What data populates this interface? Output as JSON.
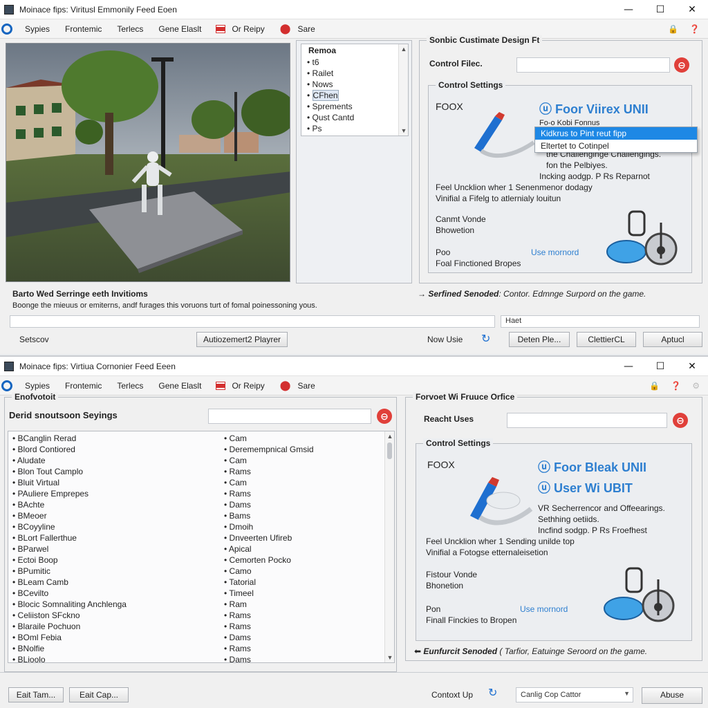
{
  "window1": {
    "title": "Moinace fips: Viritusl Emmonily Feed Eoen",
    "controls": {
      "minimize": "—",
      "maximize": "☐",
      "close": "✕"
    },
    "menu": [
      "Sypies",
      "Frontemic",
      "Terlecs",
      "Gene Elaslt",
      "Or Reipy",
      "Sare"
    ],
    "list_panel": {
      "header": "Remoa",
      "items": [
        "t6",
        "Railet",
        "Nows",
        "CFhen",
        "Sprements",
        "Qust Cantd",
        "Ps"
      ],
      "selected_index": 3
    },
    "right_panel": {
      "title": "Sonbic Custimate Design Ft",
      "control_files_label": "Control Filec.",
      "control_files_value": "",
      "control_settings_title": "Control Settings",
      "foox": "FOOX",
      "brand": "Foor Viirex UNII",
      "line_partial": "Fo-o Kobi Fonnus",
      "dropdown": [
        "Kidkrus to Pint reut fipp",
        "Eltertet to Cotinpel"
      ],
      "text_lines": [
        "the Challenginge Challengings.",
        "fon the Pelbiyes.",
        "Incking aodgp. P Rs Reparnot",
        "Feel Uncklion wher 1 Senenmenor dodagy",
        "Vinifial a Fifelg to atlernialy louitun"
      ],
      "block2": [
        "Canmt Vonde",
        "Bhowetion"
      ],
      "block3_left": "Poo",
      "block3_link": "Use mornord",
      "block3_bottom": "Foal Finctioned Bropes"
    },
    "bottom": {
      "hint_title": "Barto Wed Serringe eeth Invitioms",
      "hint_text": "Boonge the mieuus or emiterns, andf furages this voruons turt of fomal poinessoning yous.",
      "arrow_text_bold": "Serfined Senoded",
      "arrow_text_rest": ": Contor. Edmnge Surpord on the game.",
      "input_left": "",
      "input_right": "Haet",
      "status": "Setscov",
      "center_button": "Autiozemert2 Playrer",
      "now_use": "Now Usie",
      "buttons": [
        "Deten Ple...",
        "ClettierCL",
        "Aptucl"
      ]
    }
  },
  "window2": {
    "title": "Moinace fips: Virtiua Cornonier Feed Eeen",
    "controls": {
      "minimize": "—",
      "maximize": "☐",
      "close": "✕"
    },
    "menu": [
      "Sypies",
      "Frontemic",
      "Terlecs",
      "Gene Elaslt",
      "Or Reipy",
      "Sare"
    ],
    "left_panel": {
      "title": "Enofvotoit",
      "settings_title": "Derid snoutsoon Seyings",
      "search_value": "",
      "col1": [
        "BCanglin Rerad",
        "Blord Contiored",
        "Aludate",
        "Blon Tout Camplo",
        "Bluit Virtual",
        "PAuliere Emprepes",
        "BAchte",
        "BMeoer",
        "BCoyyline",
        "BLort Fallerthue",
        "BParwel",
        "Ectoi Boop",
        "BPumitic",
        "BLeam Camb",
        "BCevilto",
        "Blocic Somnaliting Anchlenga",
        "Celiiston SFckno",
        "Blaraile Pochuon",
        "BOml Febia",
        "BNolfie",
        "BLioolo"
      ],
      "col2": [
        "Cam",
        "Deremempnical Gmsid",
        "Cam",
        "Rams",
        "Cam",
        "Rams",
        "Dams",
        "Bams",
        "Dmoih",
        "Dnveerten Ufireb",
        "Apical",
        "Cemorten Pocko",
        "Camo",
        "Tatorial",
        "Timeel",
        "Ram",
        "Rams",
        "Rams",
        "Dams",
        "Rams",
        "Dams"
      ]
    },
    "right_panel": {
      "title": "Forvoet Wi Fruuce Orfice",
      "reset_label": "Reacht Uses",
      "reset_value": "",
      "control_settings_title": "Control Settings",
      "foox": "FOOX",
      "brand1": "Foor Bleak UNII",
      "brand2": "User Wi UBIT",
      "text_lines": [
        "VR Secherrencor and Offeearings.",
        "Sethhing oetiids.",
        "Incfind sodgp. P Rs Froefhest",
        "Feel Uncklion wher 1 Sending unilde top",
        "Vinifial a Fotogse etternaleisetion"
      ],
      "block2": [
        "Fistour Vonde",
        "Bhonetion"
      ],
      "block3_left": "Pon",
      "block3_link": "Use mornord",
      "block3_bottom": "Finall Finckies to Bropen",
      "arrow_text_bold": "Eunfurcit Senoded",
      "arrow_text_rest": "( Tarfior, Eatuinge Seroord on the game."
    },
    "bottom": {
      "buttons_left": [
        "Eait Tam...",
        "Eait Cap..."
      ],
      "contexts": "Contoxt Up",
      "select_value": "Canlig Cop Cattor",
      "about": "Abuse"
    }
  },
  "colors": {
    "accent": "#2e7fd0",
    "selection": "#1e88e5",
    "close_red": "#e0403a"
  }
}
